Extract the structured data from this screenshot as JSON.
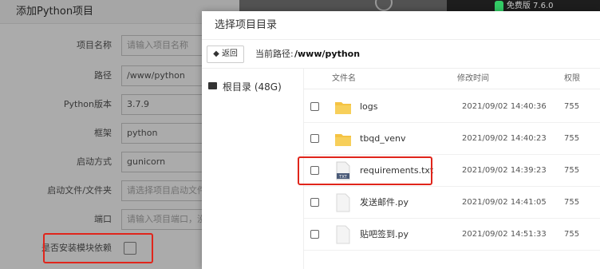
{
  "background_window": {
    "title": "添加Python项目",
    "fields": [
      {
        "label": "项目名称",
        "value": "",
        "placeholder": "请输入项目名称"
      },
      {
        "label": "路径",
        "value": "/www/python",
        "placeholder": ""
      },
      {
        "label": "Python版本",
        "value": "3.7.9",
        "placeholder": ""
      },
      {
        "label": "框架",
        "value": "python",
        "placeholder": ""
      },
      {
        "label": "启动方式",
        "value": "gunicorn",
        "placeholder": ""
      },
      {
        "label": "启动文件/文件夹",
        "value": "",
        "placeholder": "请选择项目启动文件"
      },
      {
        "label": "端口",
        "value": "",
        "placeholder": "请输入项目端口，没有"
      }
    ],
    "install_deps_label": "是否安装模块依赖",
    "install_deps_checked": false
  },
  "topbar": {
    "badge": " ",
    "text": "免费版 7.6.0"
  },
  "dialog": {
    "title": "选择项目目录",
    "back_label": "返回",
    "back_icon": "arrow-left-icon",
    "path_label": "当前路径:",
    "path_value": "/www/python",
    "sidebar_root": "根目录 (48G)",
    "columns": {
      "name": "文件名",
      "modified": "修改时间",
      "perm": "权限"
    },
    "files": [
      {
        "name": "logs",
        "type": "folder",
        "modified": "2021/09/02 14:40:36",
        "perm": "755"
      },
      {
        "name": "tbqd_venv",
        "type": "folder",
        "modified": "2021/09/02 14:40:23",
        "perm": "755"
      },
      {
        "name": "requirements.txt",
        "type": "txt",
        "modified": "2021/09/02 14:39:23",
        "perm": "755"
      },
      {
        "name": "发送邮件.py",
        "type": "file",
        "modified": "2021/09/02 14:41:05",
        "perm": "755"
      },
      {
        "name": "贴吧签到.py",
        "type": "file",
        "modified": "2021/09/02 14:51:33",
        "perm": "755"
      }
    ]
  },
  "colors": {
    "highlight": "#e0251b",
    "folder": "#f5c343"
  }
}
